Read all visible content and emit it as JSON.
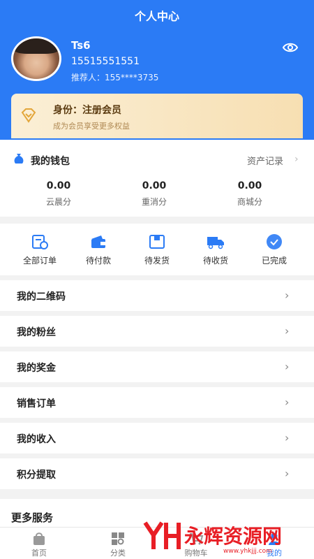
{
  "header": {
    "title": "个人中心"
  },
  "profile": {
    "username": "Ts6",
    "phone": "15515551551",
    "referrer": "推荐人：155****3735"
  },
  "member": {
    "title": "身份：注册会员",
    "subtitle": "成为会员享受更多权益"
  },
  "wallet": {
    "title": "我的钱包",
    "asset_link": "资产记录",
    "stats": [
      {
        "value": "0.00",
        "label": "云晨分"
      },
      {
        "value": "0.00",
        "label": "重消分"
      },
      {
        "value": "0.00",
        "label": "商城分"
      }
    ]
  },
  "orders": [
    {
      "label": "全部订单"
    },
    {
      "label": "待付款"
    },
    {
      "label": "待发货"
    },
    {
      "label": "待收货"
    },
    {
      "label": "已完成"
    }
  ],
  "menu": [
    {
      "label": "我的二维码"
    },
    {
      "label": "我的粉丝"
    },
    {
      "label": "我的奖金"
    },
    {
      "label": "销售订单"
    },
    {
      "label": "我的收入"
    },
    {
      "label": "积分提取"
    }
  ],
  "more": {
    "title": "更多服务"
  },
  "tabs": [
    {
      "label": "首页"
    },
    {
      "label": "分类"
    },
    {
      "label": "购物车"
    },
    {
      "label": "我的"
    }
  ],
  "watermark": {
    "text": "永辉资源网",
    "url": "www.yhkjjj.com"
  },
  "colors": {
    "primary": "#2b7bf5",
    "member_bg": "#f7dfb2",
    "watermark": "#e81e25"
  }
}
